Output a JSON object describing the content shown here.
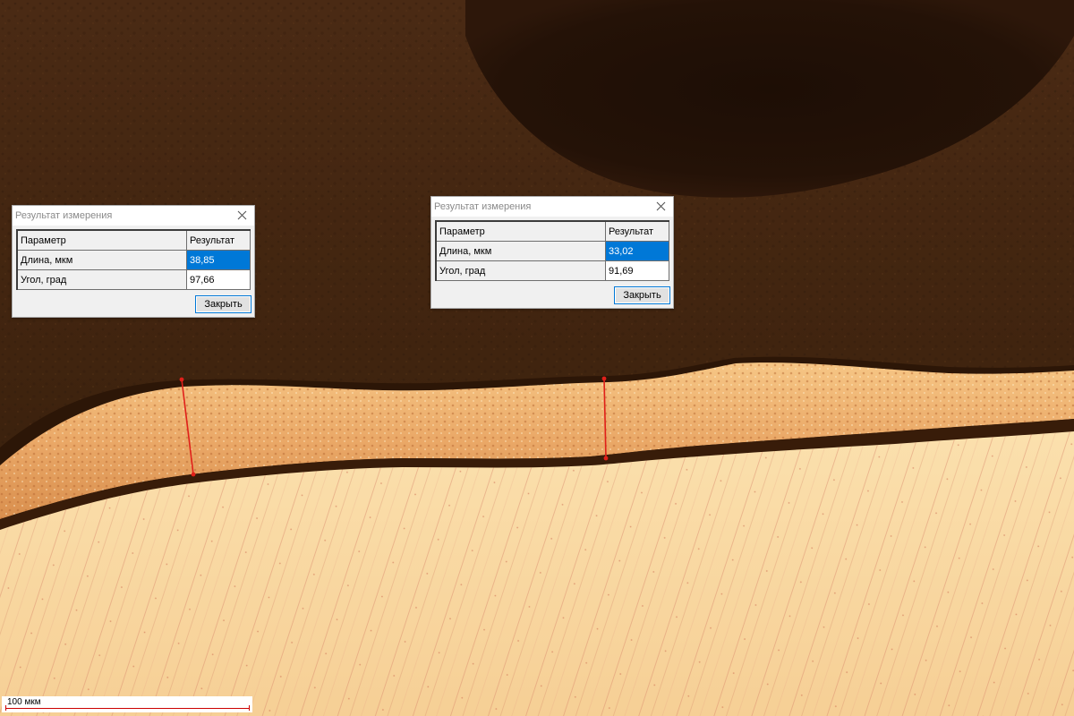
{
  "colors": {
    "background_dark": "#3a220f",
    "layer_bright": "#f2b877",
    "substrate": "#f8d6a0",
    "measure_line": "#e0201a",
    "selection": "#0078d7"
  },
  "dialogs": [
    {
      "title": "Результат измерения",
      "close_icon": "close-icon",
      "headers": {
        "param": "Параметр",
        "result": "Результат"
      },
      "rows": [
        {
          "param": "Длина, мкм",
          "value": "38,85",
          "selected": true
        },
        {
          "param": "Угол, град",
          "value": "97,66",
          "selected": false
        }
      ],
      "close_button": "Закрыть"
    },
    {
      "title": "Результат измерения",
      "close_icon": "close-icon",
      "headers": {
        "param": "Параметр",
        "result": "Результат"
      },
      "rows": [
        {
          "param": "Длина, мкм",
          "value": "33,02",
          "selected": true
        },
        {
          "param": "Угол, град",
          "value": "91,69",
          "selected": false
        }
      ],
      "close_button": "Закрыть"
    }
  ],
  "scale_bar": {
    "label": "100 мкм"
  }
}
